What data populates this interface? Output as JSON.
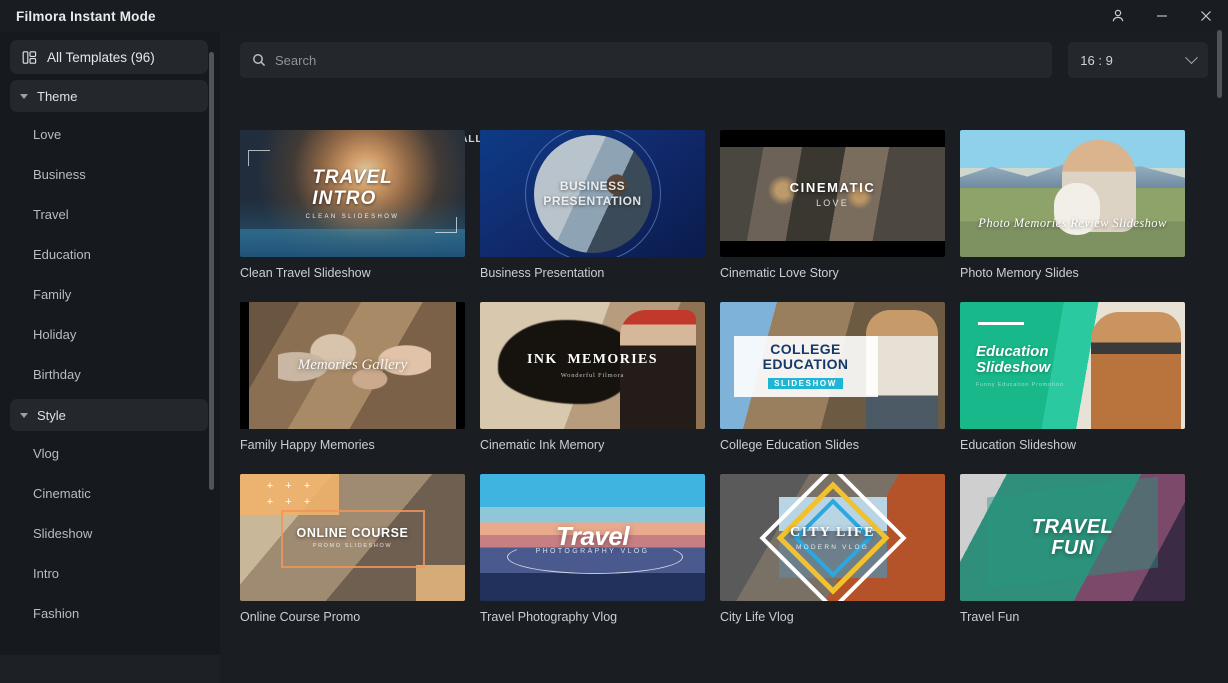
{
  "window": {
    "title": "Filmora Instant Mode",
    "controls": [
      {
        "name": "account",
        "icon": "person-icon",
        "label": ""
      },
      {
        "name": "minimize",
        "icon": "minimize-icon",
        "label": ""
      },
      {
        "name": "close",
        "icon": "close-icon",
        "label": ""
      }
    ]
  },
  "sidebar": {
    "all_templates": {
      "label": "All Templates (96)",
      "icon": "grid-layout-icon",
      "count": 96
    },
    "groups": [
      {
        "label": "Theme",
        "expanded": true,
        "items": [
          "Love",
          "Business",
          "Travel",
          "Education",
          "Family",
          "Holiday",
          "Birthday"
        ]
      },
      {
        "label": "Style",
        "expanded": true,
        "items": [
          "Vlog",
          "Cinematic",
          "Slideshow",
          "Intro",
          "Fashion"
        ]
      }
    ]
  },
  "toolbar": {
    "search": {
      "placeholder": "Search",
      "value": "",
      "icon": "search-icon"
    },
    "ratio": {
      "value": "16 : 9",
      "icon": "chevron-down-icon"
    }
  },
  "main": {
    "section_label": "ALL TEMPLATES",
    "templates": [
      {
        "label": "Clean Travel Slideshow",
        "art": "t-travelintro",
        "title": "TRAVEL\nINTRO",
        "subtitle": "CLEAN SLIDESHOW"
      },
      {
        "label": "Business Presentation",
        "art": "t-business",
        "title": "BUSINESS\nPRESENTATION",
        "subtitle": ""
      },
      {
        "label": "Cinematic Love Story",
        "art": "t-cinelove",
        "title": "CINEMATIC",
        "subtitle": "LOVE"
      },
      {
        "label": "Photo Memory Slides",
        "art": "t-photomem",
        "title": "Photo Memories Review Slideshow",
        "subtitle": ""
      },
      {
        "label": "Family Happy Memories",
        "art": "t-family",
        "title": "Memories Gallery",
        "subtitle": ""
      },
      {
        "label": "Cinematic Ink Memory",
        "art": "t-ink",
        "title": "INK  MEMORIES",
        "subtitle": "Wonderful Filmora"
      },
      {
        "label": "College Education Slides",
        "art": "t-college",
        "title": "COLLEGE\nEDUCATION",
        "subtitle": "SLIDESHOW"
      },
      {
        "label": "Education Slideshow",
        "art": "t-eduslide",
        "title": "Education\nSlideshow",
        "subtitle": "Funny Education Promotion"
      },
      {
        "label": "Online Course Promo",
        "art": "t-online",
        "title": "ONLINE COURSE",
        "subtitle": "PROMO SLIDESHOW"
      },
      {
        "label": "Travel Photography Vlog",
        "art": "t-travelvlog",
        "title": "Travel",
        "subtitle": "PHOTOGRAPHY VLOG"
      },
      {
        "label": "City Life Vlog",
        "art": "t-citylife",
        "title": "CITY LIFE",
        "subtitle": "MODERN VLOG"
      },
      {
        "label": "Travel Fun",
        "art": "t-travelfun",
        "title": "TRAVEL\nFUN",
        "subtitle": ""
      }
    ]
  },
  "colors": {
    "window_bg": "#191c20",
    "sidebar_bg": "#16191d",
    "main_bg": "#1a1d21",
    "control_bg": "#24282d",
    "text_primary": "#e4e6ea",
    "text_secondary": "#b7bcc3",
    "scrollbar": "#4e545c"
  }
}
